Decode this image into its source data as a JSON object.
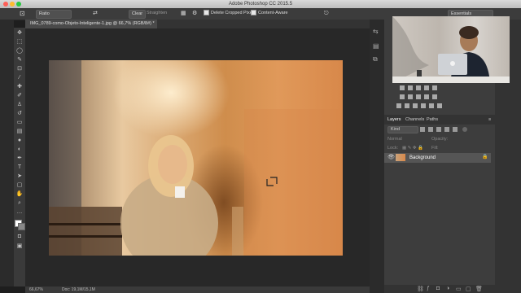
{
  "window": {
    "title": "Adobe Photoshop CC 2015.5"
  },
  "options_bar": {
    "ratio_label": "Ratio",
    "clear_label": "Clear",
    "straighten_label": "Straighten",
    "delete_cropped_label": "Delete Cropped Pixels",
    "content_aware_label": "Content-Aware",
    "workspace_label": "Essentials"
  },
  "document": {
    "tab_label": "IMG_0789-como-Objeto-Inteligente-1.jpg @ 66,7% (RGB/8#) *"
  },
  "status": {
    "zoom": "66,67%",
    "doc_info": "Doc: 19,1M/15,1M"
  },
  "layers_panel": {
    "tabs": [
      "Layers",
      "Channels",
      "Paths"
    ],
    "kind_label": "Kind",
    "blend_mode": "Normal",
    "opacity_label": "Opacity:",
    "lock_label": "Lock:",
    "fill_label": "Fill:",
    "layer_name": "Background"
  },
  "colors": {
    "accent": "#3a78c4",
    "panel_bg": "#3d3d3d"
  }
}
